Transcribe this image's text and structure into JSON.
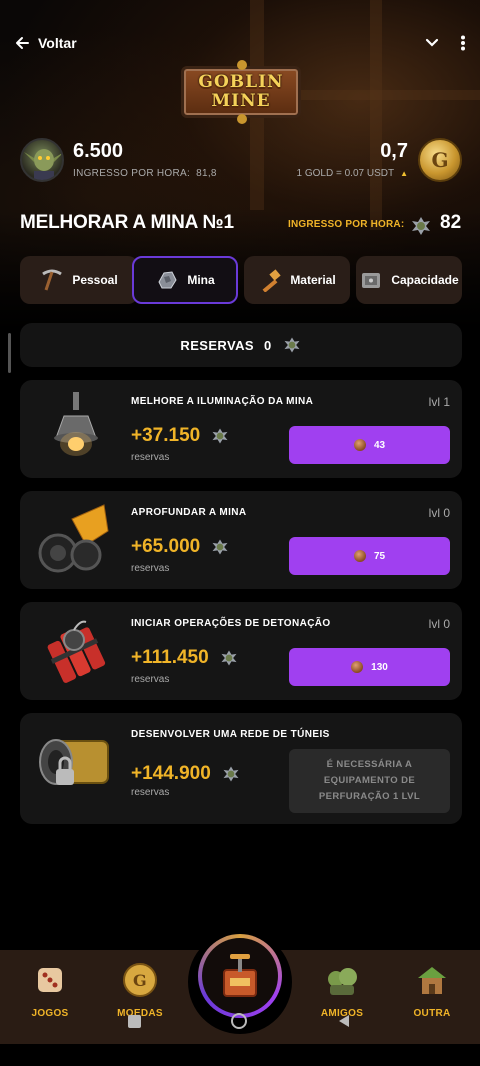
{
  "topbar": {
    "back_label": "Voltar"
  },
  "logo": {
    "line1": "GOBLIN",
    "line2": "MINE"
  },
  "stats": {
    "coins": "6.500",
    "ingresso_label": "INGRESSO POR HORA:",
    "ingresso_value": "81,8",
    "gold": "0,7",
    "gold_rate": "1 GOLD = 0.07 USDT"
  },
  "mine": {
    "title": "MELHORAR A MINA №1",
    "hour_label": "INGRESSO POR HORA:",
    "hour_value": "82"
  },
  "tabs": [
    {
      "label": "Pessoal",
      "active": false
    },
    {
      "label": "Mina",
      "active": true
    },
    {
      "label": "Material",
      "active": false
    },
    {
      "label": "Capacidade",
      "active": false
    }
  ],
  "reserves": {
    "label": "RESERVAS",
    "value": "0"
  },
  "cards": [
    {
      "name": "MELHORE A ILUMINAÇÃO DA MINA",
      "level": "lvl 1",
      "amount": "+37.150",
      "sub": "reservas",
      "cost": "43",
      "icon": "lamp-icon"
    },
    {
      "name": "APROFUNDAR A MINA",
      "level": "lvl 0",
      "amount": "+65.000",
      "sub": "reservas",
      "cost": "75",
      "icon": "drill-icon"
    },
    {
      "name": "INICIAR OPERAÇÕES DE DETONAÇÃO",
      "level": "lvl 0",
      "amount": "+111.450",
      "sub": "reservas",
      "cost": "130",
      "icon": "dynamite-icon"
    },
    {
      "name": "DESENVOLVER UMA REDE DE TÚNEIS",
      "level": "",
      "amount": "+144.900",
      "sub": "reservas",
      "locked_text": "É NECESSÁRIA A EQUIPAMENTO DE PERFURAÇÃO 1 LVL",
      "icon": "tunnel-icon"
    }
  ],
  "nav": [
    {
      "label": "JOGOS",
      "icon": "dice-icon"
    },
    {
      "label": "MOEDAS",
      "icon": "gold-coin-icon"
    },
    {
      "label": "AMIGOS",
      "icon": "goblins-icon"
    },
    {
      "label": "OUTRA",
      "icon": "hut-icon"
    }
  ],
  "colors": {
    "accent_gold": "#f0b428",
    "button_purple": "#a040f0",
    "tab_active_border": "#6a3ad8"
  }
}
